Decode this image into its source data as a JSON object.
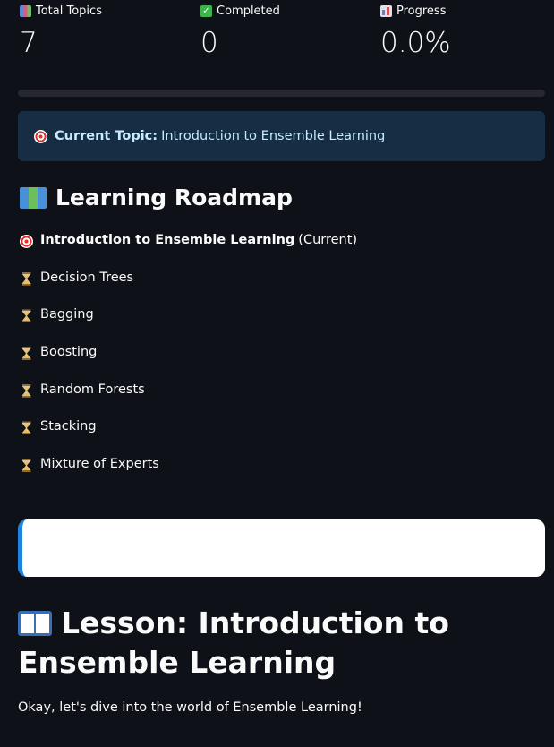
{
  "metrics": [
    {
      "icon": "books-icon",
      "label": "Total Topics",
      "value": "7"
    },
    {
      "icon": "check-icon",
      "label": "Completed",
      "value": "0"
    },
    {
      "icon": "bar-chart-icon",
      "label": "Progress",
      "value": "0.0%"
    }
  ],
  "progress": {
    "fraction": 0.0,
    "fill_color": "#ff4b4b"
  },
  "current_topic": {
    "label": "Current Topic:",
    "value": "Introduction to Ensemble Learning"
  },
  "roadmap": {
    "title": "Learning Roadmap",
    "items": [
      {
        "label": "Introduction to Ensemble Learning",
        "suffix": "(Current)",
        "icon": "target-icon"
      },
      {
        "label": "Decision Trees",
        "icon": "hourglass-icon"
      },
      {
        "label": "Bagging",
        "icon": "hourglass-icon"
      },
      {
        "label": "Boosting",
        "icon": "hourglass-icon"
      },
      {
        "label": "Random Forests",
        "icon": "hourglass-icon"
      },
      {
        "label": "Stacking",
        "icon": "hourglass-icon"
      },
      {
        "label": "Mixture of Experts",
        "icon": "hourglass-icon"
      }
    ]
  },
  "lesson": {
    "title": "Lesson: Introduction to Ensemble Learning",
    "intro": "Okay, let's dive into the world of Ensemble Learning!"
  },
  "colors": {
    "background": "#0e1117",
    "info_bg": "#172d43",
    "info_text": "#c7ebff",
    "accent": "#1c83e1"
  }
}
